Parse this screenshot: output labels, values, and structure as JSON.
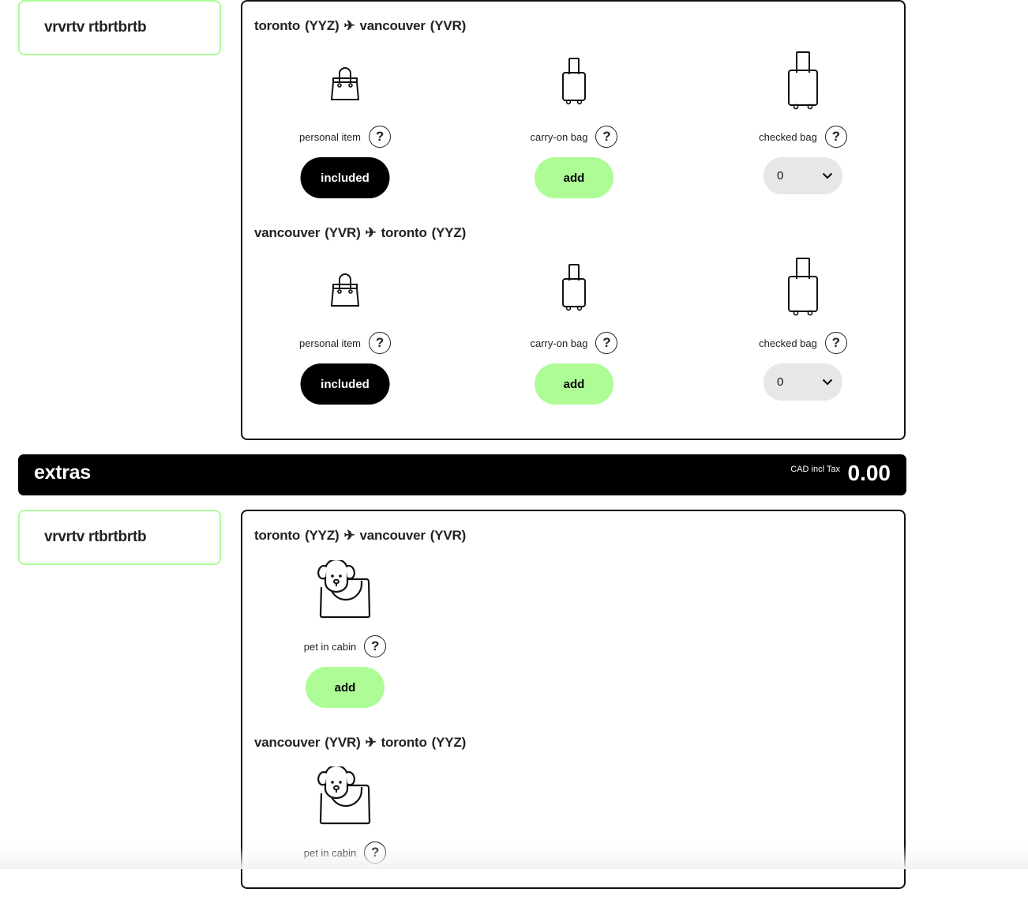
{
  "baggage": {
    "passenger_name": "vrvrtv rtbrtbrtb",
    "segments": [
      {
        "origin_city": "toronto",
        "origin_code": "(YYZ)",
        "destination_city": "vancouver",
        "destination_code": "(YVR)",
        "items": [
          {
            "label": "personal item",
            "icon": "handbag-icon",
            "control": "button",
            "control_label": "included"
          },
          {
            "label": "carry-on bag",
            "icon": "carry-on-suitcase-icon",
            "control": "button",
            "control_label": "add"
          },
          {
            "label": "checked bag",
            "icon": "checked-suitcase-icon",
            "control": "select",
            "selected_value": "0"
          }
        ]
      },
      {
        "origin_city": "vancouver",
        "origin_code": "(YVR)",
        "destination_city": "toronto",
        "destination_code": "(YYZ)",
        "items": [
          {
            "label": "personal item",
            "icon": "handbag-icon",
            "control": "button",
            "control_label": "included"
          },
          {
            "label": "carry-on bag",
            "icon": "carry-on-suitcase-icon",
            "control": "button",
            "control_label": "add"
          },
          {
            "label": "checked bag",
            "icon": "checked-suitcase-icon",
            "control": "select",
            "selected_value": "0"
          }
        ]
      }
    ]
  },
  "extras": {
    "title": "extras",
    "price_label": "CAD incl Tax",
    "price_value": "0.00",
    "passenger_name": "vrvrtv rtbrtbrtb",
    "segments": [
      {
        "origin_city": "toronto",
        "origin_code": "(YYZ)",
        "destination_city": "vancouver",
        "destination_code": "(YVR)",
        "items": [
          {
            "label": "pet in cabin",
            "icon": "pet-carrier-icon",
            "control": "button",
            "control_label": "add"
          }
        ]
      },
      {
        "origin_city": "vancouver",
        "origin_code": "(YVR)",
        "destination_city": "toronto",
        "destination_code": "(YYZ)",
        "items": [
          {
            "label": "pet in cabin",
            "icon": "pet-carrier-icon"
          }
        ]
      }
    ]
  },
  "icons": {
    "plane": "✈",
    "help": "?"
  },
  "colors": {
    "accent_green": "#aefc96",
    "black": "#000000",
    "select_bg": "#e6e7e7"
  }
}
